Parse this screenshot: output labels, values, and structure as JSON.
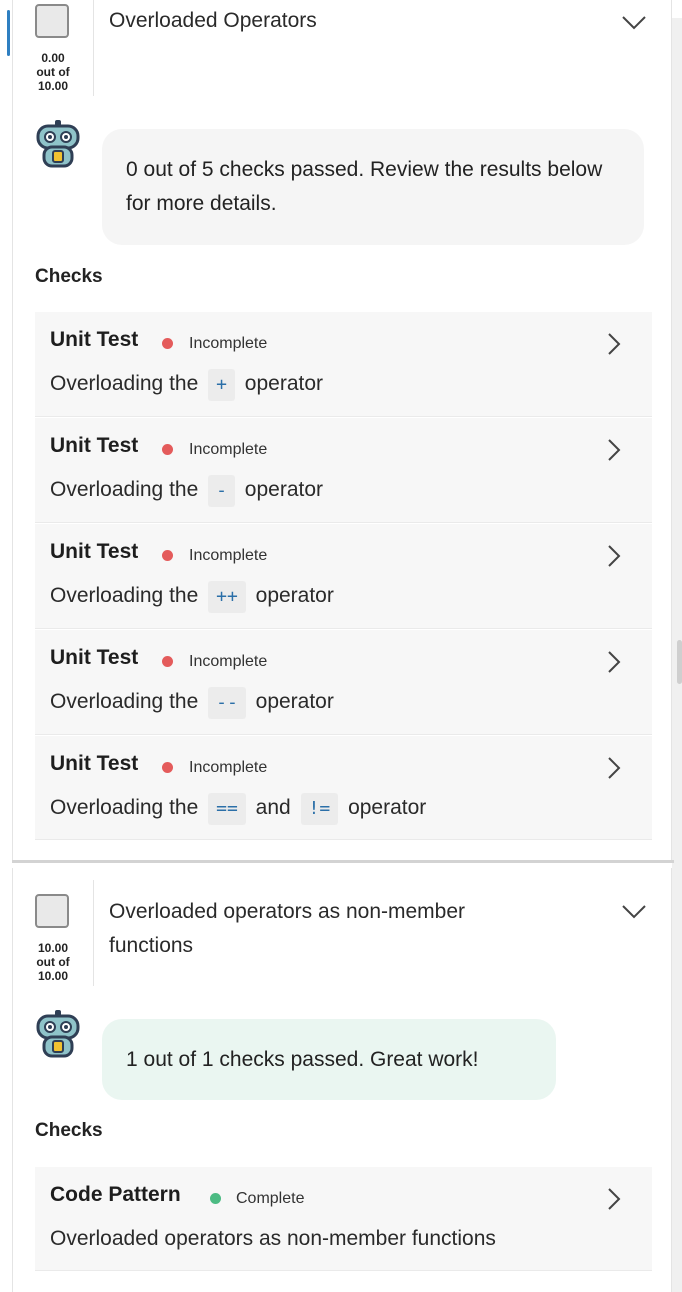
{
  "tasks": [
    {
      "title": "Overloaded Operators",
      "score": "0.00",
      "out_of": "out of",
      "total": "10.00",
      "feedback": "0 out of 5 checks passed. Review the results below for more details.",
      "checks_heading": "Checks",
      "checks": [
        {
          "kind": "Unit Test",
          "status": "Incomplete",
          "desc_pre": "Overloading the",
          "code1": "+",
          "mid": "",
          "code2": "",
          "desc_post": "operator"
        },
        {
          "kind": "Unit Test",
          "status": "Incomplete",
          "desc_pre": "Overloading the",
          "code1": "-",
          "mid": "",
          "code2": "",
          "desc_post": "operator"
        },
        {
          "kind": "Unit Test",
          "status": "Incomplete",
          "desc_pre": "Overloading the",
          "code1": "++",
          "mid": "",
          "code2": "",
          "desc_post": "operator"
        },
        {
          "kind": "Unit Test",
          "status": "Incomplete",
          "desc_pre": "Overloading the",
          "code1": "--",
          "mid": "",
          "code2": "",
          "desc_post": "operator"
        },
        {
          "kind": "Unit Test",
          "status": "Incomplete",
          "desc_pre": "Overloading the",
          "code1": "==",
          "mid": "and",
          "code2": "!=",
          "desc_post": "operator"
        }
      ]
    },
    {
      "title_line1": "Overloaded operators as non-member",
      "title_line2": "functions",
      "score": "10.00",
      "out_of": "out of",
      "total": "10.00",
      "feedback": "1 out of 1 checks passed. Great work!",
      "checks_heading": "Checks",
      "checks": [
        {
          "kind": "Code Pattern",
          "status": "Complete",
          "desc": "Overloaded operators as non-member functions"
        }
      ]
    }
  ],
  "colors": {
    "incomplete": "#e45b5b",
    "complete": "#4cbb83",
    "accent": "#2e7fc1",
    "code": "#2b6fa8"
  },
  "icons": {
    "expand": "chevron-down-icon",
    "open": "chevron-right-icon",
    "assistant": "robot-avatar-icon"
  }
}
